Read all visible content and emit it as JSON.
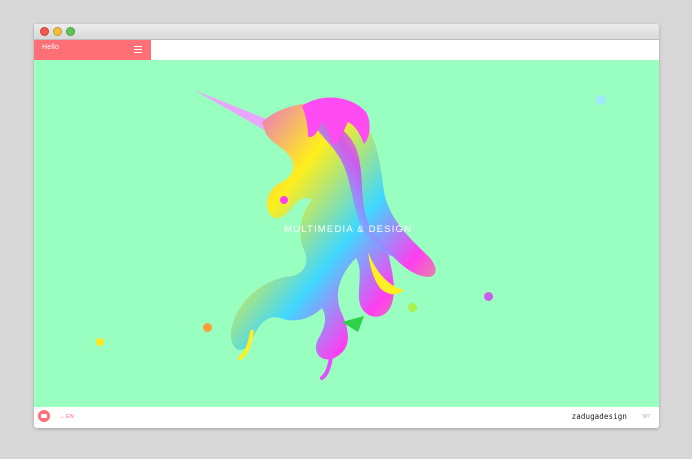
{
  "header": {
    "hello_label": "Hello",
    "menu_icon": "hamburger-menu-icon"
  },
  "hero": {
    "tagline": "MULTIMEDIA & DESIGN",
    "image": "iridescent-unicorn-illustration",
    "background": "#99ffc0"
  },
  "footer": {
    "lang_label": "→ EN",
    "brand": "zadugadesign",
    "corner_tag": "W?"
  },
  "colors": {
    "accent": "#ff6f76",
    "stage": "#99ffc0"
  }
}
